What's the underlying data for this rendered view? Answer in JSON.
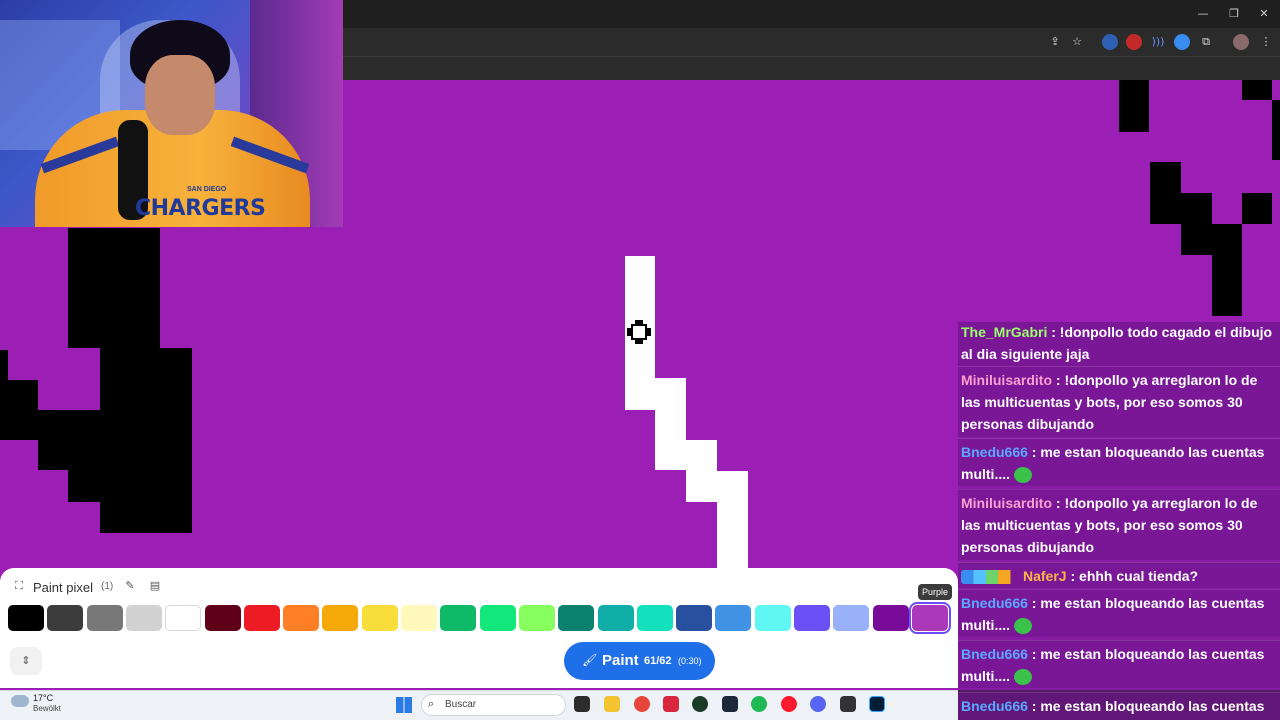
{
  "window": {
    "minimize": "—",
    "restore": "❐",
    "close": "✕"
  },
  "panel": {
    "title": "Paint pixel",
    "count": "(1)",
    "tooltip": "Purple",
    "colors": [
      {
        "name": "Black",
        "hex": "#000000"
      },
      {
        "name": "Dark Gray",
        "hex": "#3c3c3c"
      },
      {
        "name": "Gray",
        "hex": "#787878"
      },
      {
        "name": "Light Gray",
        "hex": "#d2d2d2"
      },
      {
        "name": "White",
        "hex": "#ffffff"
      },
      {
        "name": "Deep Red",
        "hex": "#600018"
      },
      {
        "name": "Red",
        "hex": "#ed1c24"
      },
      {
        "name": "Orange",
        "hex": "#ff7f27"
      },
      {
        "name": "Gold",
        "hex": "#f6aa09"
      },
      {
        "name": "Yellow",
        "hex": "#f9dd3b"
      },
      {
        "name": "Light Yellow",
        "hex": "#fffabc"
      },
      {
        "name": "Dark Green",
        "hex": "#0eb968"
      },
      {
        "name": "Green",
        "hex": "#13e67b"
      },
      {
        "name": "Light Green",
        "hex": "#87ff5e"
      },
      {
        "name": "Dark Teal",
        "hex": "#0c816e"
      },
      {
        "name": "Teal",
        "hex": "#10aea6"
      },
      {
        "name": "Light Teal",
        "hex": "#13e1be"
      },
      {
        "name": "Dark Blue",
        "hex": "#28509e"
      },
      {
        "name": "Blue",
        "hex": "#4093e4"
      },
      {
        "name": "Cyan",
        "hex": "#60f7f2"
      },
      {
        "name": "Indigo",
        "hex": "#6b50f6"
      },
      {
        "name": "Light Indigo",
        "hex": "#99b1fb"
      },
      {
        "name": "Dark Purple",
        "hex": "#780c99"
      },
      {
        "name": "Purple",
        "hex": "#aa38b9"
      }
    ],
    "selected": "Purple",
    "paint_label": "Paint",
    "paint_count": "61/62",
    "paint_timer": "(0:30)"
  },
  "chat": {
    "messages": [
      {
        "user": "The_MrGabri",
        "color": "#9bff6a",
        "text": " : !donpollo todo cagado el dibujo al dia siguiente jaja"
      },
      {
        "user": "Miniluisardito",
        "color": "#ff9ed0",
        "text": " : !donpollo ya arreglaron lo de las multicuentas y bots, por eso somos 30 personas dibujando"
      },
      {
        "user": "Bnedu666",
        "color": "#5aa8ff",
        "text": " : me estan bloqueando las cuentas multi...."
      },
      {
        "user": "Miniluisardito",
        "color": "#ff9ed0",
        "text": " : !donpollo ya arreglaron lo de las multicuentas y bots, por eso somos 30 personas dibujando"
      },
      {
        "user": "NaferJ",
        "color": "#ffb347",
        "text": " : ehhh cual tienda?"
      },
      {
        "user": "Bnedu666",
        "color": "#5aa8ff",
        "text": " : me estan bloqueando las cuentas multi...."
      },
      {
        "user": "Bnedu666",
        "color": "#5aa8ff",
        "text": " : me estan bloqueando las cuentas multi...."
      },
      {
        "user": "Bnedu666",
        "color": "#5aa8ff",
        "text": " : me estan bloqueando las cuentas"
      }
    ]
  },
  "webcam": {
    "shirt_text": "CHARGERS",
    "shirt_small": "SAN DIEGO"
  },
  "taskbar": {
    "temperature": "17°C",
    "weather": "Bewölkt",
    "search_placeholder": "Buscar"
  }
}
